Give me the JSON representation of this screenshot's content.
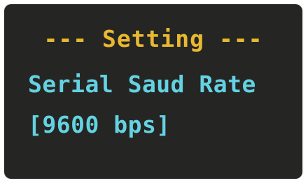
{
  "display": {
    "title": "--- Setting ---",
    "setting_label": "Serial Saud Rate",
    "setting_value": "[9600 bps]"
  },
  "colors": {
    "background": "#252623",
    "title": "#e8b830",
    "text": "#64d2e2"
  }
}
